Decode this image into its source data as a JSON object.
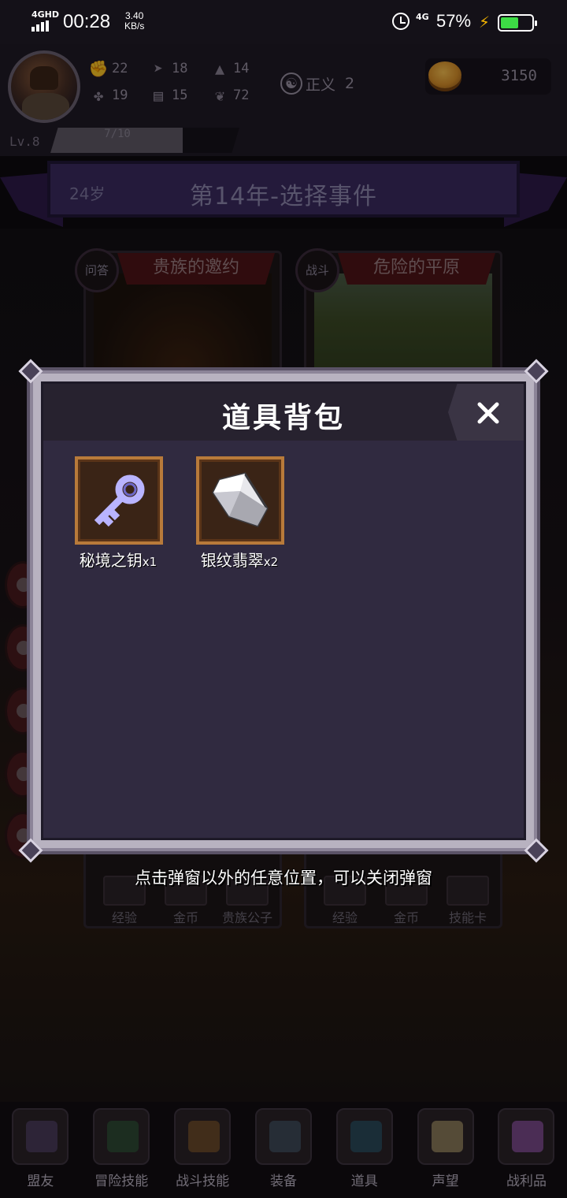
{
  "status_bar": {
    "network": "4GHD",
    "time": "00:28",
    "speed_value": "3.40",
    "speed_unit": "KB/s",
    "cell": "4G",
    "battery_pct": "57%",
    "battery_level": 0.57,
    "icons": [
      "signal-icon",
      "alarm-icon",
      "charging-icon",
      "battery-icon"
    ]
  },
  "player": {
    "stats": [
      {
        "icon": "fist-icon",
        "value": "22"
      },
      {
        "icon": "boot-icon",
        "value": "18"
      },
      {
        "icon": "wizard-hat-icon",
        "value": "14"
      },
      {
        "icon": "clover-icon",
        "value": "19"
      },
      {
        "icon": "book-icon",
        "value": "15"
      },
      {
        "icon": "lotus-icon",
        "value": "72"
      }
    ],
    "alignment_label": "正义",
    "alignment_value": "2",
    "gold": "3150",
    "level_label": "Lv.8",
    "xp_text": "7/10",
    "xp_fraction": 0.7
  },
  "year_banner": {
    "age": "24岁",
    "title": "第14年-选择事件"
  },
  "event_cards": [
    {
      "tag": "问答",
      "title": "贵族的邀约",
      "rewards": [
        "经验",
        "金币",
        "贵族公子"
      ]
    },
    {
      "tag": "战斗",
      "title": "危险的平原",
      "rewards": [
        "经验",
        "金币",
        "技能卡"
      ]
    }
  ],
  "modal": {
    "title": "道具背包",
    "close_icon": "close-icon",
    "items": [
      {
        "name": "秘境之钥",
        "qty": "x1",
        "icon": "key-icon"
      },
      {
        "name": "银纹翡翠",
        "qty": "x2",
        "icon": "gem-icon"
      }
    ]
  },
  "hint": "点击弹窗以外的任意位置，可以关闭弹窗",
  "bottom_nav": [
    {
      "label": "盟友",
      "icon": "gloves-icon"
    },
    {
      "label": "冒险技能",
      "icon": "spellbook-icon"
    },
    {
      "label": "战斗技能",
      "icon": "backpack-icon"
    },
    {
      "label": "装备",
      "icon": "crossed-swords-icon"
    },
    {
      "label": "道具",
      "icon": "pouch-icon"
    },
    {
      "label": "声望",
      "icon": "scroll-icon"
    },
    {
      "label": "战利品",
      "icon": "treasure-chest-icon"
    }
  ]
}
